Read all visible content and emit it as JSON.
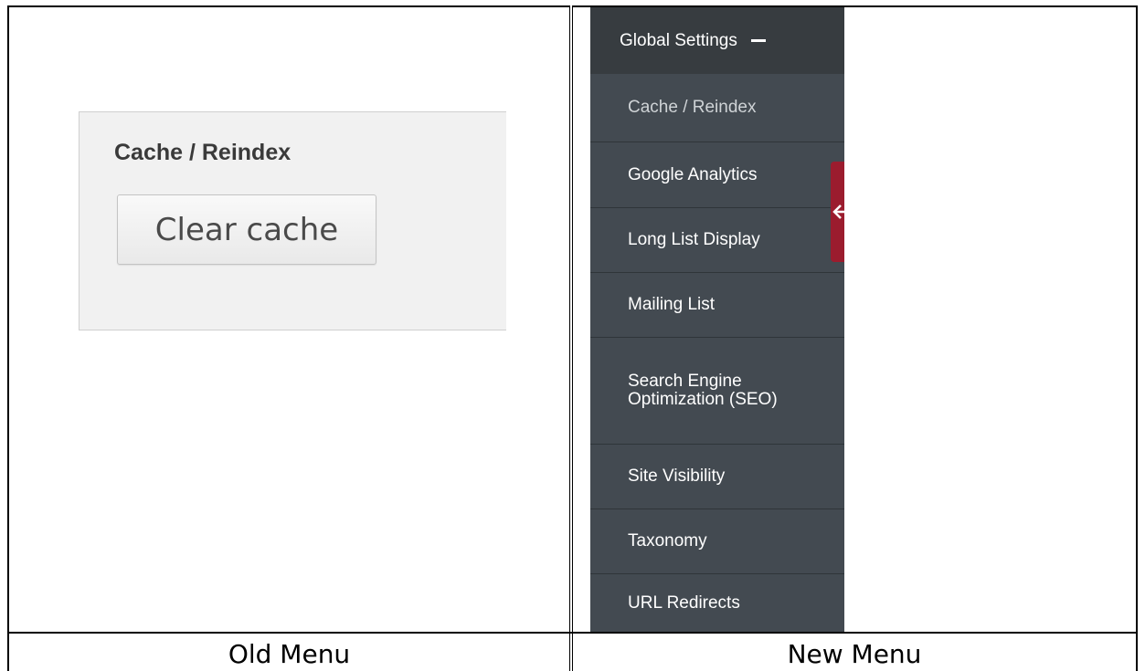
{
  "old_menu": {
    "title": "Cache / Reindex",
    "button_label": "Clear cache"
  },
  "new_menu": {
    "header_label": "Global Settings",
    "items": [
      {
        "label": "Cache / Reindex",
        "active": true
      },
      {
        "label": "Google Analytics"
      },
      {
        "label": "Long List Display"
      },
      {
        "label": "Mailing List"
      },
      {
        "label": "Search Engine Optimization (SEO)"
      },
      {
        "label": "Site Visibility"
      },
      {
        "label": "Taxonomy"
      },
      {
        "label": "URL Redirects"
      }
    ]
  },
  "captions": {
    "old": "Old Menu",
    "new": "New Menu"
  },
  "colors": {
    "sidebar_bg": "#434a51",
    "sidebar_header_bg": "#373c40",
    "collapse_tab": "#9b1c2e",
    "old_panel_bg": "#f1f1f1"
  }
}
